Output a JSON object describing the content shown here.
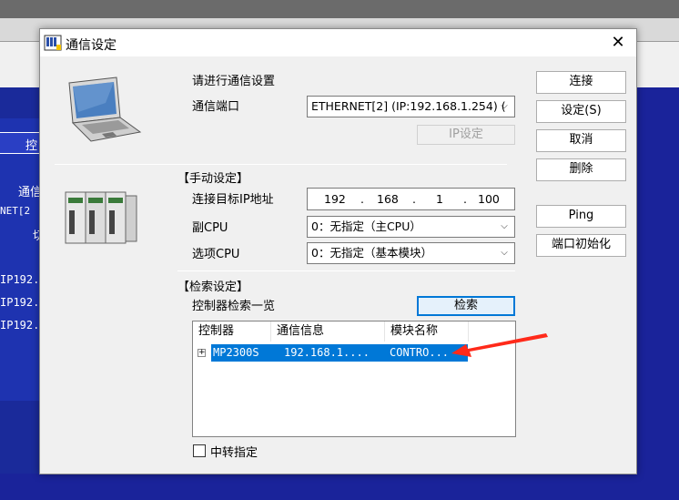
{
  "background": {
    "left_labels": [
      "控",
      "通信",
      "NET[2",
      "切",
      "IP192.",
      "IP192.",
      "IP192."
    ]
  },
  "dialog": {
    "title": "通信设定",
    "close_glyph": "✕",
    "prompt": "请进行通信设置",
    "port_label": "通信端口",
    "port_value": "ETHERNET[2]  (IP:192.168.1.254) (",
    "ip_setting_button": "IP设定",
    "manual_section": "【手动设定】",
    "target_ip_label": "连接目标IP地址",
    "target_ip": [
      "192",
      "168",
      "1",
      "100"
    ],
    "ip_dot": ".",
    "sub_cpu_label": "副CPU",
    "sub_cpu_value": "0：无指定（主CPU）",
    "option_cpu_label": "选项CPU",
    "option_cpu_value": "0：无指定（基本模块）",
    "search_section": "【检索设定】",
    "controller_list_label": "控制器检索一览",
    "search_button": "检索",
    "list": {
      "columns": [
        "控制器",
        "通信信息",
        "模块名称"
      ],
      "rows": [
        {
          "controller": "MP2300S",
          "comm": "192.168.1....",
          "module": "CONTRO...",
          "expander": "+"
        }
      ]
    },
    "relay_checkbox_label": "中转指定",
    "buttons": {
      "connect": "连接",
      "settings": "设定(S)",
      "cancel": "取消",
      "delete": "删除",
      "ping": "Ping",
      "port_init": "端口初始化"
    },
    "chevron": "⌵",
    "accent_color": "#0078d7",
    "annotation_arrow_color": "#ff2a1a"
  }
}
